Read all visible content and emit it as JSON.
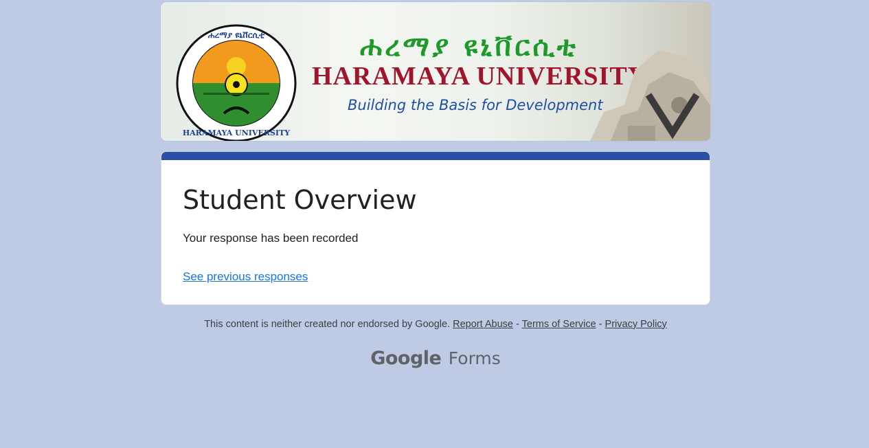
{
  "banner": {
    "amharic_name": "ሐረማያ ዩኒቨርሲቲ",
    "english_name": "HARAMAYA UNIVERSITY",
    "tagline": "Building the Basis for Development",
    "seal_text_top": "ሐረማያ ዩኒቨርሲቲ",
    "seal_text_bottom": "HARAMAYA UNIVERSITY"
  },
  "form": {
    "title": "Student Overview",
    "confirmation_message": "Your response has been recorded",
    "previous_responses_link": "See previous responses",
    "accent_color": "#2b4ea6"
  },
  "footer": {
    "disclaimer": "This content is neither created nor endorsed by Google.",
    "report_abuse": "Report Abuse",
    "separator": "-",
    "terms": "Terms of Service",
    "privacy": "Privacy Policy",
    "brand_google": "Google",
    "brand_forms": "Forms"
  },
  "colors": {
    "background": "#bfcae4",
    "link": "#1a73e8"
  }
}
